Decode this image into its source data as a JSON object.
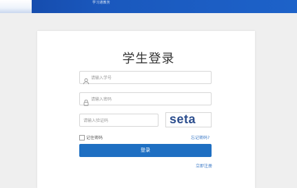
{
  "header": {
    "logo_text": "学习通教务"
  },
  "login": {
    "title": "学生登录",
    "username_placeholder": "请输入学号",
    "password_placeholder": "请输入密码",
    "captcha_placeholder": "请输入验证码",
    "captcha_text": "seta",
    "remember_label": "记住密码",
    "forgot_label": "忘记密码?",
    "login_button": "登录",
    "register_link": "立即注册"
  },
  "colors": {
    "header": "#1a58bd",
    "primary": "#1e6fc2",
    "link": "#3a78c6"
  },
  "icons": {
    "username": "user-icon",
    "password": "lock-icon"
  }
}
